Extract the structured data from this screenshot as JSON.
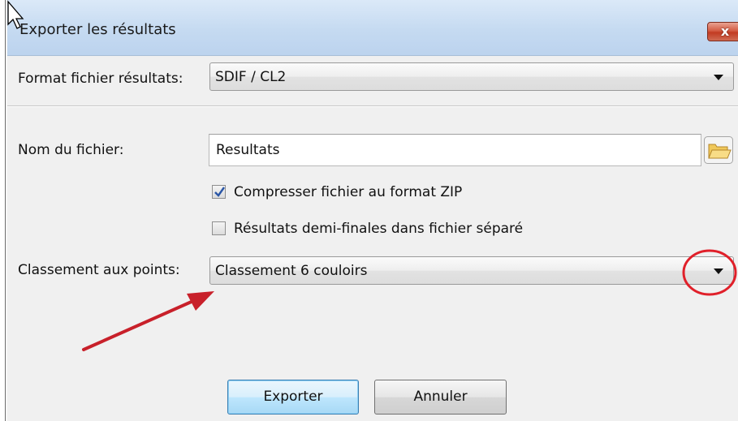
{
  "window": {
    "title": "Exporter les résultats",
    "close_label": "x"
  },
  "format": {
    "label": "Format fichier résultats:",
    "selected": "SDIF / CL2"
  },
  "filename": {
    "label": "Nom du fichier:",
    "value": "Resultats",
    "browse_icon": "folder-icon"
  },
  "options": {
    "zip_label": "Compresser fichier au format ZIP",
    "zip_checked": true,
    "semis_label": "Résultats demi-finales dans fichier séparé",
    "semis_checked": false
  },
  "ranking": {
    "label": "Classement aux points:",
    "selected": "Classement 6 couloirs"
  },
  "actions": {
    "export_label": "Exporter",
    "cancel_label": "Annuler"
  },
  "annotations": {
    "arrow_color": "#c8202a",
    "circle_color": "#e0202a"
  },
  "colors": {
    "titlebar": "#c5daf1",
    "default_button_border": "#3c7fb1"
  }
}
